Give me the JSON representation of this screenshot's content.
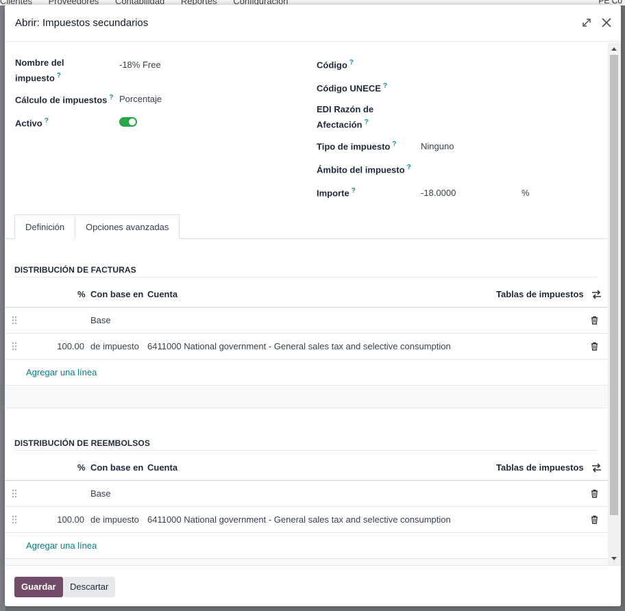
{
  "background": {
    "menu": [
      "Clientes",
      "Proveedores",
      "Contabilidad",
      "Reportes",
      "Configuración"
    ],
    "right_text": "PE Co"
  },
  "modal": {
    "title": "Abrir: Impuestos secundarios",
    "expand_icon": "expand-icon",
    "close_icon": "close-icon"
  },
  "form": {
    "left": {
      "tax_name_label_1": "Nombre del",
      "tax_name_label_2": "impuesto",
      "tax_name_value": "-18% Free",
      "computation_label": "Cálculo de impuestos",
      "computation_value": "Porcentaje",
      "active_label": "Activo",
      "active_value": true
    },
    "right": {
      "code_label": "Código",
      "unece_label": "Código UNECE",
      "edi_label_1": "EDI Razón de",
      "edi_label_2": "Afectación",
      "tax_type_label": "Tipo de impuesto",
      "tax_type_value": "Ninguno",
      "scope_label": "Ámbito del impuesto",
      "amount_label": "Importe",
      "amount_value": "-18.0000",
      "amount_unit": "%"
    },
    "tooltip_mark": "?"
  },
  "tabs": [
    {
      "label": "Definición",
      "active": true
    },
    {
      "label": "Opciones avanzadas",
      "active": false
    }
  ],
  "columns": {
    "percent": "%",
    "based_on": "Con base en",
    "account": "Cuenta",
    "tax_grids": "Tablas de impuestos"
  },
  "invoice_distribution": {
    "title": "DISTRIBUCIÓN DE FACTURAS",
    "rows": [
      {
        "percent": "",
        "based_on": "Base",
        "account": ""
      },
      {
        "percent": "100.00",
        "based_on": "de impuesto",
        "account": "6411000 National government - General sales tax and selective consumption"
      }
    ],
    "add_line": "Agregar una línea"
  },
  "refund_distribution": {
    "title": "DISTRIBUCIÓN DE REEMBOLSOS",
    "rows": [
      {
        "percent": "",
        "based_on": "Base",
        "account": ""
      },
      {
        "percent": "100.00",
        "based_on": "de impuesto",
        "account": "6411000 National government - General sales tax and selective consumption"
      }
    ],
    "add_line": "Agregar una línea"
  },
  "footer": {
    "save": "Guardar",
    "discard": "Descartar"
  },
  "colors": {
    "primary": "#714b67",
    "link": "#017e84",
    "toggle_on": "#28a745",
    "tooltip": "#0d8fa5"
  }
}
